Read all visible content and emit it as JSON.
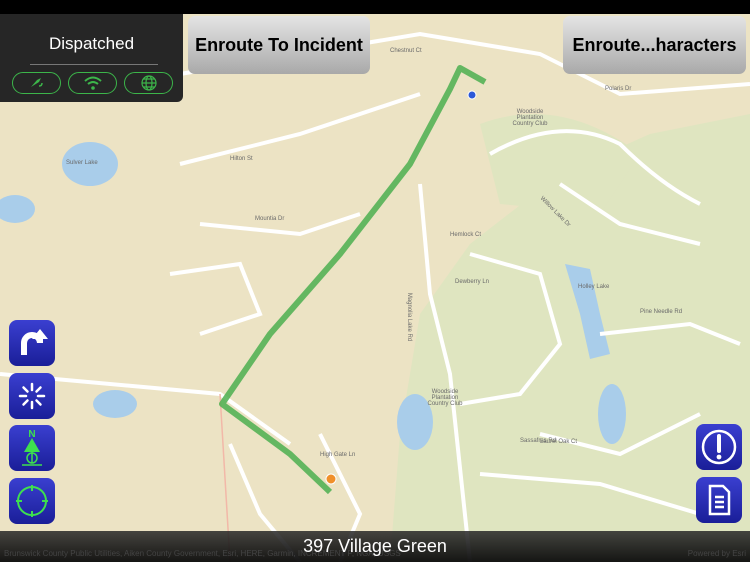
{
  "status_panel": {
    "title": "Dispatched",
    "icons": [
      "gps-satellite-icon",
      "wifi-icon",
      "globe-icon"
    ],
    "accent": "#3cb54a"
  },
  "top_buttons": {
    "left": "Enroute To Incident",
    "right": "Enroute...haracters"
  },
  "left_controls": [
    "u-turn-icon",
    "loading-spinner-icon",
    "north-up-icon",
    "locate-crosshair-icon"
  ],
  "right_controls": [
    "alert-icon",
    "document-icon"
  ],
  "map": {
    "route_color": "#4caf50",
    "labels": [
      "Sulver Lake",
      "Holley Lake",
      "Woodside Plantation Country Club",
      "Woodside Plantation Country Club",
      "Hemlock Ct",
      "Magnolia Lake Rd",
      "Dewberry Ln",
      "Pine Needle Rd",
      "Laurel Oak Ct",
      "Sassafras Rd",
      "Chestnut Ct",
      "Willow Lake Dr",
      "Hilton St",
      "Mountia Dr",
      "Polaris Dr",
      "High Gate Ln"
    ]
  },
  "bottom_bar": {
    "address": "397 Village Green",
    "attribution": "Brunswick County Public Utilities, Aiken County Government, Esri, HERE, Garmin, INCREMENT P, NGA, USGS",
    "powered_by": "Powered by Esri"
  }
}
